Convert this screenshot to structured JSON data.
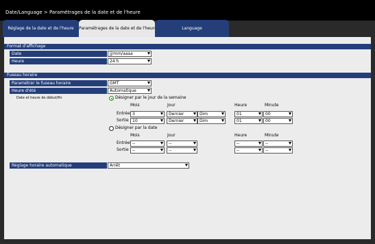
{
  "title": "Date/Language > Paramétrages de la date et de l'heure",
  "tabs": [
    {
      "label": "Réglage de la date et de l'heure",
      "active": false
    },
    {
      "label": "Paramétrages de la date et de l'heure",
      "active": true
    },
    {
      "label": "Language",
      "active": false
    }
  ],
  "format": {
    "section": "Format d'affichage",
    "date_label": "Date",
    "date_value": "jj/mm/aaaa",
    "heure_label": "Heure",
    "heure_value": "24 h"
  },
  "fuseau": {
    "section": "Fuseau horaire",
    "param_label": "Paramétrer le fuseau horaire",
    "param_value": "GMT",
    "ete_label": "Heure d'été",
    "ete_value": "Automatique",
    "debut_fin_label": "Date et heure de début/fin",
    "option_semaine": "Désigner par le jour de la semaine",
    "option_date": "Désigner par la date",
    "selected_option": "semaine",
    "col_mois": "Mois",
    "col_jour": "Jour",
    "col_heure": "Heure",
    "col_minute": "Minute",
    "row_entree": "Entrée",
    "row_sortie": "Sortie",
    "semaine_entree": {
      "mois": "3",
      "jour": "Dernier",
      "jour_semaine": "Dim",
      "heure": "01",
      "minute": "00"
    },
    "semaine_sortie": {
      "mois": "10",
      "jour": "Dernier",
      "jour_semaine": "Dim",
      "heure": "01",
      "minute": "00"
    },
    "date_entree": {
      "mois": "--",
      "jour": "--",
      "heure": "--",
      "minute": "--"
    },
    "date_sortie": {
      "mois": "--",
      "jour": "--",
      "heure": "--",
      "minute": "--"
    }
  },
  "auto": {
    "label": "Réglage horaire automatique",
    "value": "Arrêt"
  },
  "colors": {
    "header_blue": "#243e7a",
    "panel": "#ececec",
    "radio_green": "#1a8a2a"
  }
}
